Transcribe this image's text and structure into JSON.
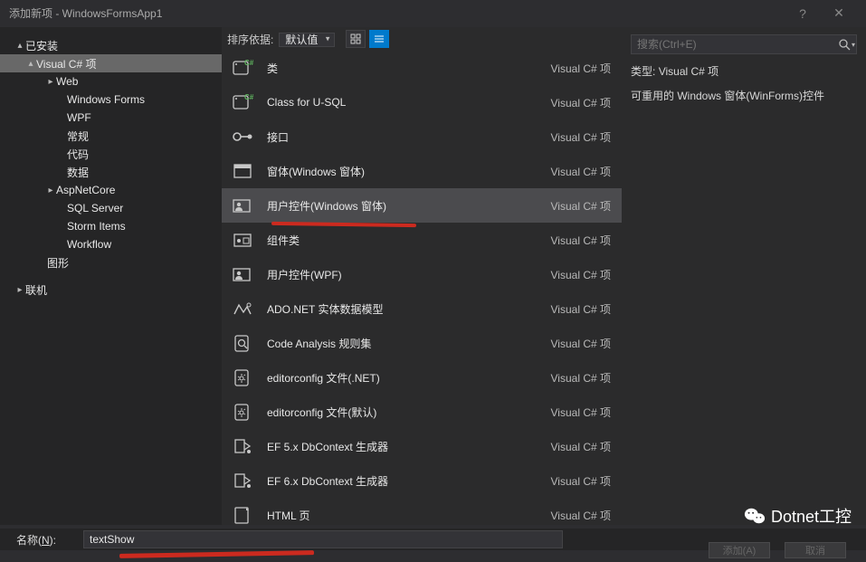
{
  "titlebar": {
    "title": "添加新项 - WindowsFormsApp1"
  },
  "tree": {
    "installed": "已安装",
    "nodes": [
      {
        "label": "Visual C# 项",
        "indent": 28,
        "caret": "▴",
        "selected": true
      },
      {
        "label": "Web",
        "indent": 50,
        "caret": "▸"
      },
      {
        "label": "Windows Forms",
        "indent": 62,
        "caret": ""
      },
      {
        "label": "WPF",
        "indent": 62,
        "caret": ""
      },
      {
        "label": "常规",
        "indent": 62,
        "caret": ""
      },
      {
        "label": "代码",
        "indent": 62,
        "caret": ""
      },
      {
        "label": "数据",
        "indent": 62,
        "caret": ""
      },
      {
        "label": "AspNetCore",
        "indent": 50,
        "caret": "▸"
      },
      {
        "label": "SQL Server",
        "indent": 62,
        "caret": ""
      },
      {
        "label": "Storm Items",
        "indent": 62,
        "caret": ""
      },
      {
        "label": "Workflow",
        "indent": 62,
        "caret": ""
      },
      {
        "label": "图形",
        "indent": 40,
        "caret": ""
      }
    ],
    "online": "联机"
  },
  "toolbar": {
    "sort_label": "排序依据:",
    "sort_value": "默认值"
  },
  "templates": [
    {
      "icon": "class-cs",
      "label": "类",
      "type": "Visual C# 项"
    },
    {
      "icon": "class-cs",
      "label": "Class for U-SQL",
      "type": "Visual C# 项"
    },
    {
      "icon": "interface",
      "label": "接口",
      "type": "Visual C# 项"
    },
    {
      "icon": "window",
      "label": "窗体(Windows 窗体)",
      "type": "Visual C# 项"
    },
    {
      "icon": "usercontrol",
      "label": "用户控件(Windows 窗体)",
      "type": "Visual C# 项",
      "selected": true
    },
    {
      "icon": "component",
      "label": "组件类",
      "type": "Visual C# 项"
    },
    {
      "icon": "usercontrol",
      "label": "用户控件(WPF)",
      "type": "Visual C# 项"
    },
    {
      "icon": "adonet",
      "label": "ADO.NET 实体数据模型",
      "type": "Visual C# 项"
    },
    {
      "icon": "analysis",
      "label": "Code Analysis 规则集",
      "type": "Visual C# 项"
    },
    {
      "icon": "config",
      "label": "editorconfig 文件(.NET)",
      "type": "Visual C# 项"
    },
    {
      "icon": "config",
      "label": "editorconfig 文件(默认)",
      "type": "Visual C# 项"
    },
    {
      "icon": "ef",
      "label": "EF 5.x DbContext 生成器",
      "type": "Visual C# 项"
    },
    {
      "icon": "ef",
      "label": "EF 6.x DbContext 生成器",
      "type": "Visual C# 项"
    },
    {
      "icon": "html",
      "label": "HTML 页",
      "type": "Visual C# 项"
    }
  ],
  "details": {
    "search_placeholder": "搜索(Ctrl+E)",
    "type_label": "类型:",
    "type_value": "Visual C# 项",
    "description": "可重用的 Windows 窗体(WinForms)控件"
  },
  "name": {
    "label": "名称(N):",
    "value": "textShow"
  },
  "buttons": {
    "add": "添加(A)",
    "cancel": "取消"
  },
  "brand": "Dotnet工控"
}
